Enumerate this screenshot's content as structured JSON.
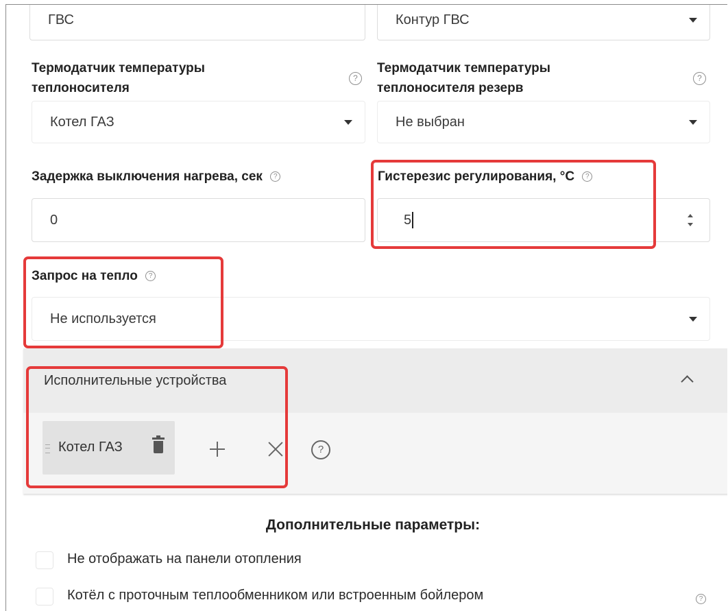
{
  "top_row": {
    "left_input_value": "ГВС",
    "right_select_value": "Контур ГВС"
  },
  "sensor": {
    "label": "Термодатчик температуры теплоносителя",
    "value": "Котел ГАЗ"
  },
  "sensor_reserve": {
    "label": "Термодатчик температуры теплоносителя резерв",
    "value": "Не выбран"
  },
  "delay": {
    "label": "Задержка выключения нагрева, сек",
    "value": "0"
  },
  "hysteresis": {
    "label": "Гистерезис регулирования, °C",
    "value": "5"
  },
  "heat_request": {
    "label": "Запрос на тепло",
    "value": "Не используется"
  },
  "actuators": {
    "title": "Исполнительные устройства",
    "chip_label": "Котел ГАЗ",
    "icons": [
      "drag-handle-icon",
      "trash-icon",
      "plus-icon",
      "close-icon",
      "help-icon",
      "chevron-up-icon"
    ]
  },
  "additional": {
    "title": "Дополнительные параметры:",
    "options": [
      {
        "label": "Не отображать на панели отопления",
        "checked": false
      },
      {
        "label": "Котёл с проточным теплообменником или встроенным бойлером",
        "checked": false
      }
    ]
  },
  "help_glyph": "?",
  "colors": {
    "highlight": "#e53a3a",
    "section_bg": "#efefef",
    "chip_bg": "#e0e0e0"
  }
}
